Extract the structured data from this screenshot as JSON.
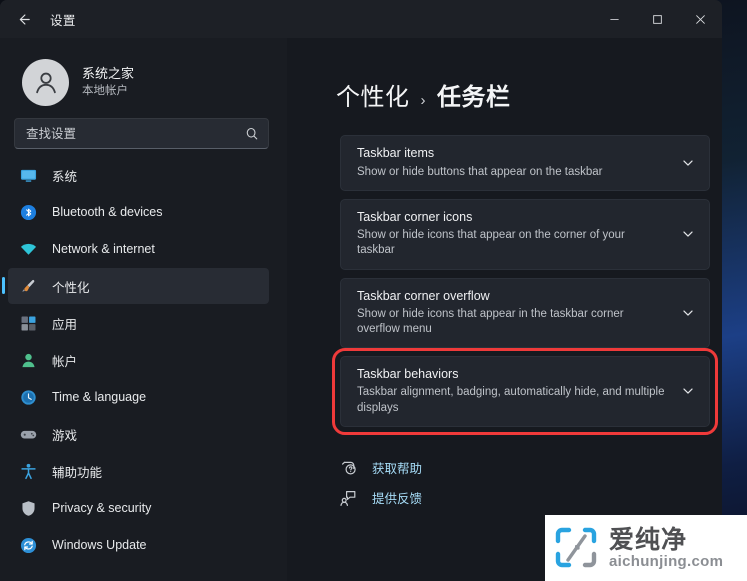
{
  "window": {
    "app_title": "设置",
    "back_icon": "back-arrow-icon",
    "controls": {
      "minimize": "minimize-icon",
      "maximize": "maximize-icon",
      "close": "close-icon"
    }
  },
  "sidebar": {
    "account": {
      "name": "系统之家",
      "subtitle": "本地帐户",
      "avatar_icon": "person-avatar-icon"
    },
    "search": {
      "placeholder": "查找设置",
      "value": "",
      "icon": "search-icon"
    },
    "items": [
      {
        "label": "系统",
        "icon": "monitor-icon",
        "selected": false
      },
      {
        "label": "Bluetooth & devices",
        "icon": "bluetooth-icon",
        "selected": false
      },
      {
        "label": "Network & internet",
        "icon": "wifi-icon",
        "selected": false
      },
      {
        "label": "个性化",
        "icon": "paintbrush-icon",
        "selected": true
      },
      {
        "label": "应用",
        "icon": "apps-icon",
        "selected": false
      },
      {
        "label": "帐户",
        "icon": "account-person-icon",
        "selected": false
      },
      {
        "label": "Time & language",
        "icon": "clock-icon",
        "selected": false
      },
      {
        "label": "游戏",
        "icon": "gamepad-icon",
        "selected": false
      },
      {
        "label": "辅助功能",
        "icon": "accessibility-icon",
        "selected": false
      },
      {
        "label": "Privacy & security",
        "icon": "shield-icon",
        "selected": false
      },
      {
        "label": "Windows Update",
        "icon": "update-refresh-icon",
        "selected": false
      }
    ]
  },
  "main": {
    "breadcrumb": {
      "parent": "个性化",
      "separator": "›",
      "current": "任务栏"
    },
    "cards": [
      {
        "title": "Taskbar items",
        "subtitle": "Show or hide buttons that appear on the taskbar",
        "chevron": "chevron-down-icon",
        "highlighted": false
      },
      {
        "title": "Taskbar corner icons",
        "subtitle": "Show or hide icons that appear on the corner of your taskbar",
        "chevron": "chevron-down-icon",
        "highlighted": false
      },
      {
        "title": "Taskbar corner overflow",
        "subtitle": "Show or hide icons that appear in the taskbar corner overflow menu",
        "chevron": "chevron-down-icon",
        "highlighted": false
      },
      {
        "title": "Taskbar behaviors",
        "subtitle": "Taskbar alignment, badging, automatically hide, and multiple displays",
        "chevron": "chevron-down-icon",
        "highlighted": true
      }
    ],
    "links": [
      {
        "label": "获取帮助",
        "icon": "help-question-icon"
      },
      {
        "label": "提供反馈",
        "icon": "feedback-icon"
      }
    ]
  },
  "watermark": {
    "cn": "爱纯净",
    "en": "aichunjing.com",
    "logo_icon": "aichunjing-logo-icon"
  },
  "colors": {
    "accent": "#4cc2ff",
    "highlight_border": "#ef3a3a",
    "link": "#a6dcf7",
    "window_bg": "#16191f",
    "sidebar_bg": "#191c22",
    "card_bg": "#22262e"
  }
}
